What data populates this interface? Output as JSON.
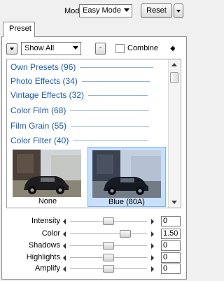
{
  "toolbar": {
    "mode_label": "Mode",
    "mode_value": "Easy Mode",
    "reset_label": "Reset"
  },
  "tabs": [
    {
      "label": "Preset",
      "active": true
    }
  ],
  "filter": {
    "show_value": "Show All",
    "minus_label": "-",
    "combine_label": "Combine",
    "combine_checked": false,
    "back_icon": "left-arrow-icon"
  },
  "categories": [
    {
      "label": "Own Presets (96)"
    },
    {
      "label": "Photo Effects (34)"
    },
    {
      "label": "Vintage Effects (32)"
    },
    {
      "label": "Color Film (68)"
    },
    {
      "label": "Film Grain (55)"
    },
    {
      "label": "Color Filter (40)"
    }
  ],
  "presets": [
    {
      "label": "None",
      "selected": false
    },
    {
      "label": "Blue (80A)",
      "selected": true
    }
  ],
  "sliders": [
    {
      "label": "Intensity",
      "value": "0",
      "fraction": 0.5
    },
    {
      "label": "Color",
      "value": "1.50",
      "fraction": 0.75
    },
    {
      "label": "Shadows",
      "value": "0",
      "fraction": 0.5
    },
    {
      "label": "Highlights",
      "value": "0",
      "fraction": 0.5
    },
    {
      "label": "Amplify",
      "value": "0",
      "fraction": 0.5
    }
  ],
  "colors": {
    "accent": "#1e5aa8",
    "selection": "#c8e0fb"
  }
}
